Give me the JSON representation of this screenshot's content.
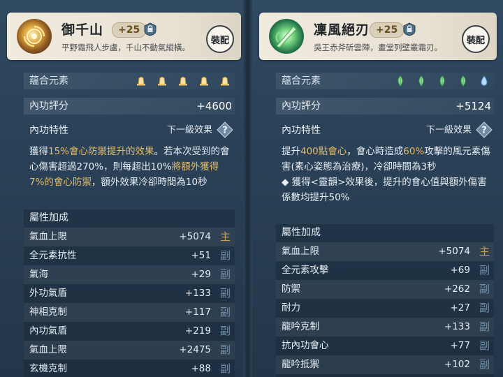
{
  "left": {
    "item_name": "御千山",
    "level": "+25",
    "item_desc": "平野霜飛人步盧，千山不動氣縱橫。",
    "equip_label": "裝配",
    "element_label": "蘊合元素",
    "element_icon": "gold-bell-gem-icon",
    "score_label": "內功評分",
    "score_value": "+4600",
    "trait_label": "內功特性",
    "next_level_label": "下一級效果",
    "trait_parts": [
      {
        "text": "獲得",
        "gold": false
      },
      {
        "text": "15%會心防禦提升的效果",
        "gold": true
      },
      {
        "text": "。若本次受到的會心傷害超過270%，則每超出10%",
        "gold": false
      },
      {
        "text": "將額外獲得7%的會心防禦",
        "gold": true
      },
      {
        "text": "，額外效果冷卻時間為10秒",
        "gold": false
      }
    ],
    "attr_title": "屬性加成",
    "attrs": [
      {
        "name": "氣血上限",
        "value": "+5074",
        "tag": "主"
      },
      {
        "name": "全元素抗性",
        "value": "+51",
        "tag": "副"
      },
      {
        "name": "氣海",
        "value": "+29",
        "tag": "副"
      },
      {
        "name": "外功氣盾",
        "value": "+133",
        "tag": "副"
      },
      {
        "name": "神相克制",
        "value": "+117",
        "tag": "副"
      },
      {
        "name": "內功氣盾",
        "value": "+219",
        "tag": "副"
      },
      {
        "name": "氣血上限",
        "value": "+2475",
        "tag": "副"
      },
      {
        "name": "玄機克制",
        "value": "+88",
        "tag": "副"
      }
    ]
  },
  "right": {
    "item_name": "凜風絕刃",
    "level": "+25",
    "item_desc": "吳王赤斧斫雲陣，畫堂列壁叢霜刃。",
    "equip_label": "裝配",
    "element_label": "蘊合元素",
    "score_label": "內功評分",
    "score_value": "+5124",
    "trait_label": "內功特性",
    "next_level_label": "下一級效果",
    "trait_parts": [
      {
        "text": "提升",
        "gold": false
      },
      {
        "text": "400點會心",
        "gold": true
      },
      {
        "text": "，會心時造成",
        "gold": false
      },
      {
        "text": "60%",
        "gold": true
      },
      {
        "text": "攻擊的風元素傷害(素心姿態為治療)，冷卻時間為3秒",
        "gold": false
      }
    ],
    "trait_bullet": "◆ 獲得<靈韻>效果後，提升的會心值與額外傷害係數均提升50%",
    "attr_title": "屬性加成",
    "attrs": [
      {
        "name": "氣血上限",
        "value": "+5074",
        "tag": "主"
      },
      {
        "name": "全元素攻擊",
        "value": "+69",
        "tag": "副"
      },
      {
        "name": "防禦",
        "value": "+262",
        "tag": "副"
      },
      {
        "name": "耐力",
        "value": "+27",
        "tag": "副"
      },
      {
        "name": "龍吟克制",
        "value": "+133",
        "tag": "副"
      },
      {
        "name": "抗內功會心",
        "value": "+77",
        "tag": "副"
      },
      {
        "name": "龍吟抵禦",
        "value": "+102",
        "tag": "副"
      }
    ]
  },
  "colors": {
    "gold_highlight": "#e4ba62",
    "main_tag": "#c7a055",
    "sub_tag": "#6f8da8",
    "header_bg": "#f0ebdf"
  }
}
